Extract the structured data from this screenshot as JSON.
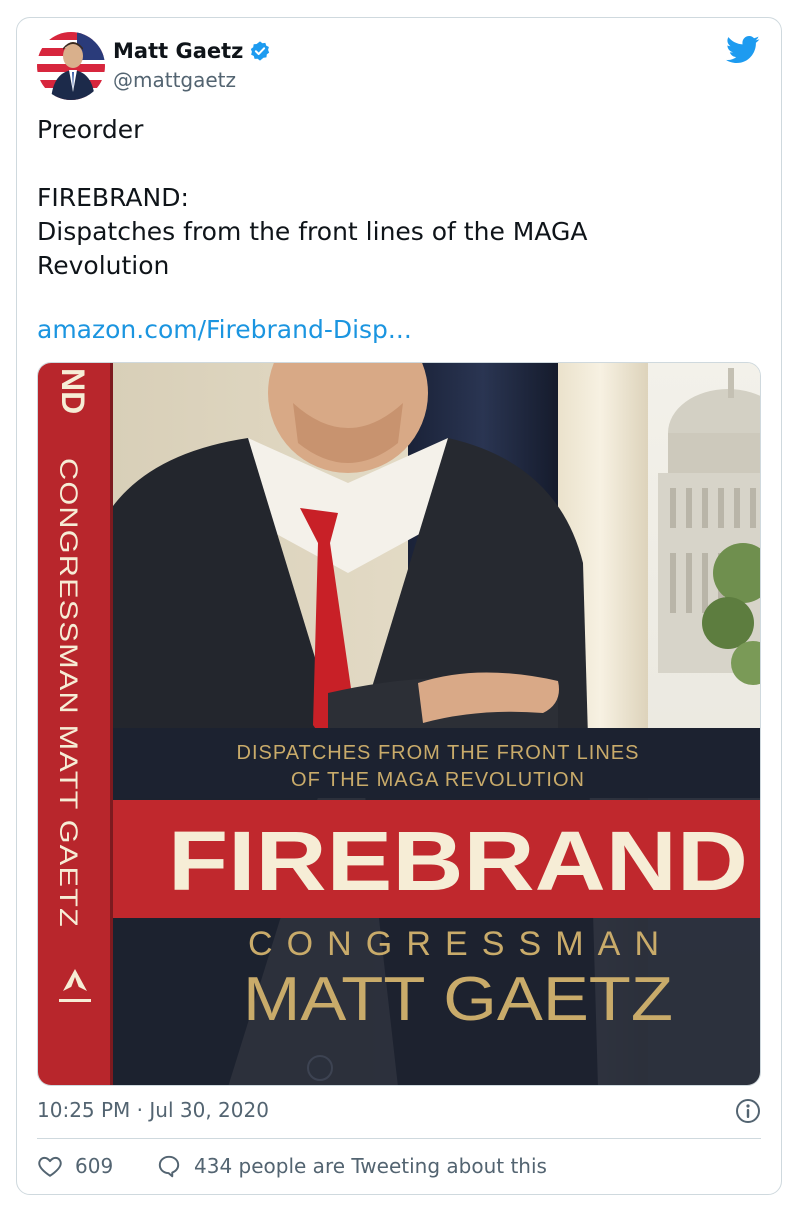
{
  "author": {
    "name": "Matt Gaetz",
    "handle": "@mattgaetz",
    "verified": true
  },
  "tweet": {
    "text": "Preorder\n\nFIREBRAND:\nDispatches from the front lines of the MAGA\nRevolution",
    "link_text": "amazon.com/Firebrand-Disp...",
    "timestamp": "10:25 PM · Jul 30, 2020"
  },
  "book_cover": {
    "spine_text": "CONGRESSMAN MATT GAETZ",
    "spine_fragment": "ND",
    "subtitle_line1": "DISPATCHES FROM THE FRONT LINES",
    "subtitle_line2": "OF THE MAGA REVOLUTION",
    "title": "FIREBRAND",
    "author_line1": "CONGRESSMAN",
    "author_line2": "MATT GAETZ",
    "colors": {
      "spine_red": "#b8262c",
      "band_red": "#c0282d",
      "dark_navy": "#1c2230",
      "cream": "#f6edd6",
      "gold": "#c9ab6a"
    }
  },
  "stats": {
    "likes": "609",
    "conversation": "434 people are Tweeting about this"
  },
  "icons": {
    "verified": "verified-badge-icon",
    "bird": "twitter-bird-icon",
    "info": "info-icon",
    "like": "heart-icon",
    "reply": "speech-bubble-icon"
  },
  "colors": {
    "link": "#1b95e0",
    "muted": "#536471",
    "border": "#cfd9de",
    "twitter_blue": "#1d9bf0"
  }
}
